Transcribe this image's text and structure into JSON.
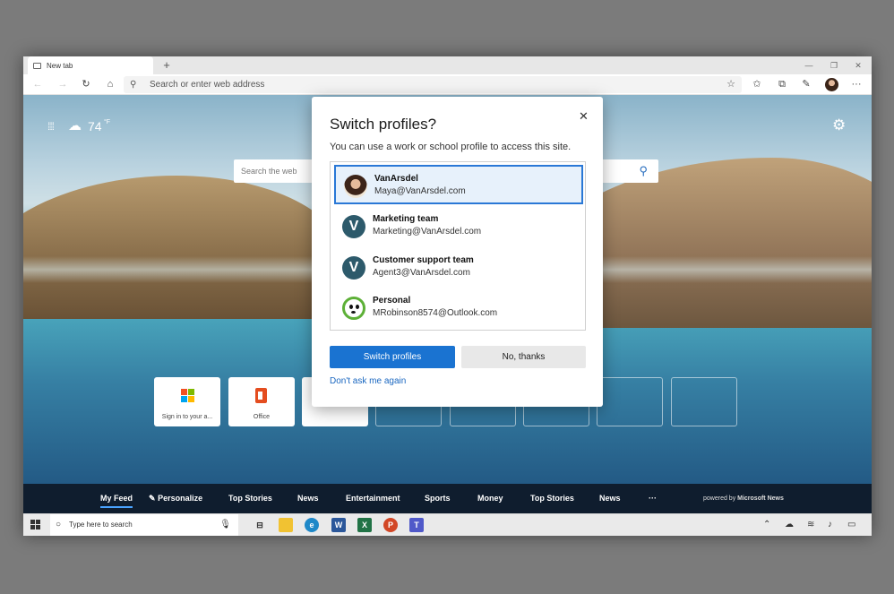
{
  "browser": {
    "tab_title": "New tab",
    "new_tab_icon": "+",
    "address_placeholder": "Search or enter web address",
    "window_controls": [
      "—",
      "❐",
      "✕"
    ]
  },
  "newtab": {
    "weather_temp": "74",
    "weather_unit": "°F",
    "search_placeholder": "Search the web",
    "tiles": [
      {
        "label": "Sign in to your a..."
      },
      {
        "label": "Office"
      }
    ]
  },
  "news": {
    "items": [
      "My Feed",
      "Personalize",
      "Top Stories",
      "News",
      "Entertainment",
      "Sports",
      "Money",
      "Top Stories",
      "News",
      "···"
    ],
    "powered_prefix": "powered by ",
    "powered_brand": "Microsoft News"
  },
  "taskbar": {
    "search_placeholder": "Type here to search"
  },
  "dialog": {
    "title": "Switch profiles?",
    "subtitle": "You can use a work or school profile to access this site.",
    "profiles": [
      {
        "name": "VanArsdel",
        "email": "Maya@VanArsdel.com"
      },
      {
        "name": "Marketing team",
        "email": "Marketing@VanArsdel.com"
      },
      {
        "name": "Customer support team",
        "email": "Agent3@VanArsdel.com"
      },
      {
        "name": "Personal",
        "email": "MRobinson8574@Outlook.com"
      }
    ],
    "primary_button": "Switch profiles",
    "secondary_button": "No, thanks",
    "link": "Don't ask me again"
  },
  "colors": {
    "accent": "#1a73d1",
    "selected_border": "#2a78d6",
    "profile_avatar": "#2d5a6b",
    "newsbar": "#0f1d2e"
  }
}
